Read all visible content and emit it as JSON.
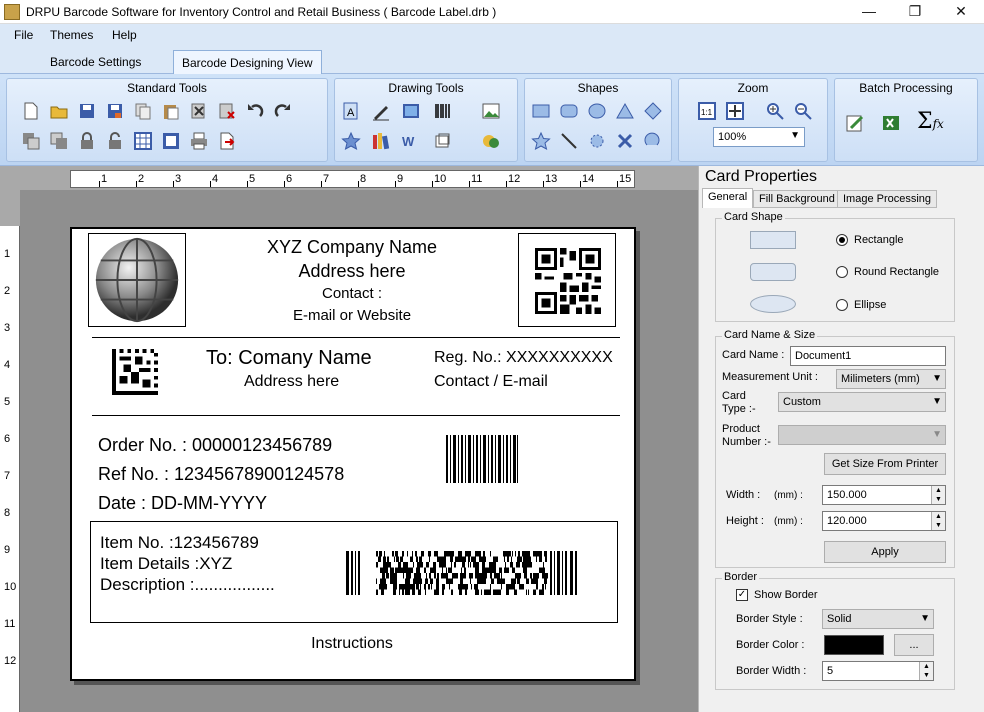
{
  "window": {
    "title": "DRPU Barcode Software for Inventory Control and Retail Business ( Barcode Label.drb )",
    "min_glyph": "—",
    "max_glyph": "❐",
    "close_glyph": "✕"
  },
  "menu": {
    "file": "File",
    "themes": "Themes",
    "help": "Help"
  },
  "view_tabs": {
    "settings": "Barcode Settings",
    "designing": "Barcode Designing View"
  },
  "ribbon": {
    "standard_tools": "Standard Tools",
    "drawing_tools": "Drawing Tools",
    "shapes": "Shapes",
    "zoom": "Zoom",
    "zoom_value": "100%",
    "batch_processing": "Batch Processing",
    "batch_sigma": "Σ",
    "batch_fx": "fx"
  },
  "ruler": {
    "h": [
      "1",
      "2",
      "3",
      "4",
      "5",
      "6",
      "7",
      "8",
      "9",
      "10",
      "11",
      "12",
      "13",
      "14",
      "15"
    ],
    "v": [
      "1",
      "2",
      "3",
      "4",
      "5",
      "6",
      "7",
      "8",
      "9",
      "10",
      "11",
      "12"
    ]
  },
  "label": {
    "company_name": "XYZ Company Name",
    "address": "Address here",
    "contact": "Contact :",
    "email": "E-mail or Website",
    "to_name": "To: Comany Name",
    "to_address": "Address here",
    "reg_no": "Reg. No.: XXXXXXXXXX",
    "contact_email": "Contact /  E-mail",
    "order_no": "Order No. : 00000123456789",
    "ref_no": "Ref No. : 12345678900124578",
    "date": "Date :  DD-MM-YYYY",
    "item_no": "Item No. :123456789",
    "item_details": "Item Details :XYZ",
    "description": "Description :.................",
    "instructions": "Instructions"
  },
  "panel": {
    "title": "Card Properties",
    "tabs": [
      "General",
      "Fill Background",
      "Image Processing"
    ],
    "card_shape": {
      "legend": "Card Shape",
      "options": [
        "Rectangle",
        "Round Rectangle",
        "Ellipse"
      ],
      "selected": "Rectangle"
    },
    "name_size": {
      "legend": "Card  Name & Size",
      "card_name_label": "Card Name :",
      "card_name_value": "Document1",
      "measurement_label": "Measurement Unit :",
      "measurement_value": "Milimeters (mm)",
      "card_type_label_1": "Card",
      "card_type_label_2": "Type :-",
      "card_type_value": "Custom",
      "product_label_1": "Product",
      "product_label_2": "Number :-",
      "product_value": "",
      "get_size_button": "Get Size From Printer",
      "width_label": "Width :",
      "width_unit": "(mm) :",
      "width_value": "150.000",
      "height_label": "Height :",
      "height_unit": "(mm) :",
      "height_value": "120.000",
      "apply_button": "Apply"
    },
    "border": {
      "legend": "Border",
      "show_border_label": "Show Border",
      "show_border_checked": true,
      "style_label": "Border Style :",
      "style_value": "Solid",
      "color_label": "Border Color :",
      "color_value": "#000000",
      "color_button": "...",
      "width_label": "Border Width :",
      "width_value": "5"
    }
  }
}
